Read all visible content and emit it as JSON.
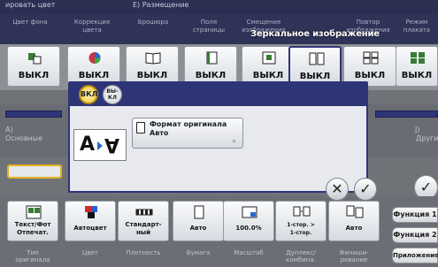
{
  "header": {
    "left_text": "ировать цвет",
    "section": "E)  Размещение"
  },
  "top_tabs": [
    "Цвет фона",
    "Коррекция\nцвета",
    "Брошюра",
    "Поля\nстраницы",
    "Смещение\nизображения",
    "Повтор\nизображения",
    "Режим\nплаката"
  ],
  "top_tiles": [
    {
      "label": "ВЫКЛ",
      "icon": "background-color-icon"
    },
    {
      "label": "ВЫКЛ",
      "icon": "color-adjust-icon"
    },
    {
      "label": "ВЫКЛ",
      "icon": "booklet-icon"
    },
    {
      "label": "ВЫКЛ",
      "icon": "page-margin-icon"
    },
    {
      "label": "ВЫКЛ",
      "icon": "image-shift-icon"
    },
    {
      "label": "ВЫКЛ",
      "icon": "mirror-image-icon"
    },
    {
      "label": "ВЫКЛ",
      "icon": "image-repeat-icon"
    },
    {
      "label": "ВЫКЛ",
      "icon": "poster-mode-icon"
    }
  ],
  "mid": {
    "left_label": "A)",
    "left_label2": "Основные",
    "right_label": "J)",
    "right_label2": "Другие"
  },
  "dialog": {
    "title": "Зеркальное изображение",
    "on_label": "ВКЛ",
    "off_label": "ВЫ-\nКЛ",
    "original_format_label": "Формат оригинала",
    "original_format_value": "Авто"
  },
  "bottom_tiles": [
    {
      "label": "Текст/Фот\nОтпечат.",
      "caption": "Тип\nоригинала",
      "icon": "original-type-icon"
    },
    {
      "label": "Автоцвет",
      "caption": "Цвет",
      "icon": "color-icon"
    },
    {
      "label": "Стандарт-\nный",
      "caption": "Плотность",
      "icon": "density-icon"
    },
    {
      "label": "Авто",
      "caption": "Бумага",
      "icon": "paper-icon"
    },
    {
      "label": "100.0%",
      "caption": "Масштаб",
      "icon": "zoom-icon"
    },
    {
      "label": "1-стор. >\n1-стор.",
      "caption": "Дуплекс/\nкомбина.",
      "icon": "duplex-icon"
    },
    {
      "label": "Авто",
      "caption": "Финиши-\nрование",
      "icon": "finishing-icon"
    }
  ],
  "side_buttons": [
    "Функция 1",
    "Функция 2",
    "Приложение"
  ]
}
